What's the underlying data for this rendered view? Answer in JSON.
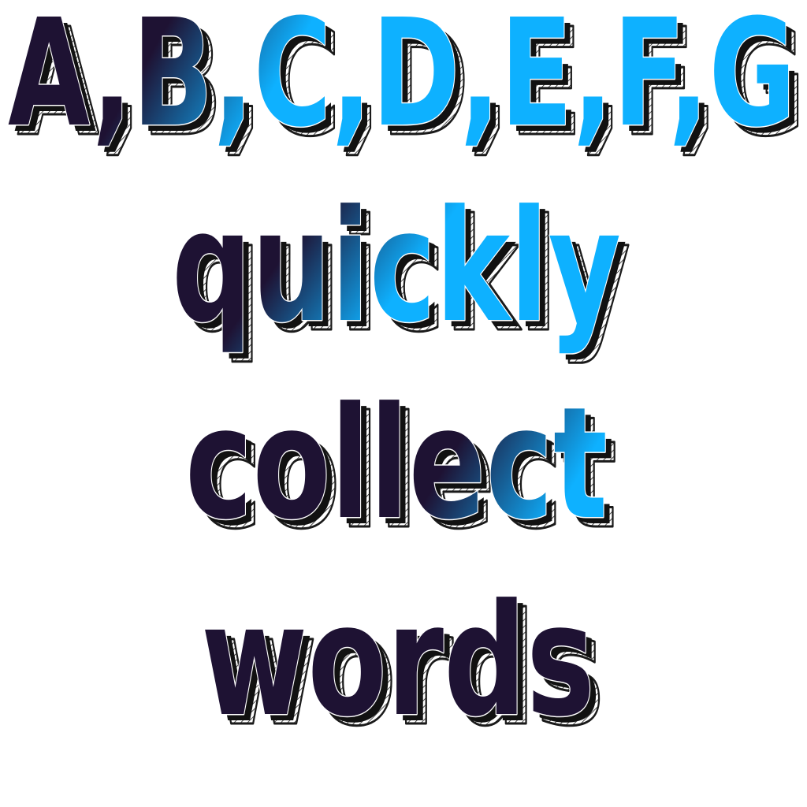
{
  "lines": [
    "A,B,C,D,E,F,G",
    "quickly",
    "collect",
    "words"
  ],
  "colors": {
    "background": "#ffffff",
    "gradient_dark": "#1e1233",
    "gradient_light": "#0eb1ff",
    "shadow": "#111111",
    "hatch": "#222222"
  }
}
